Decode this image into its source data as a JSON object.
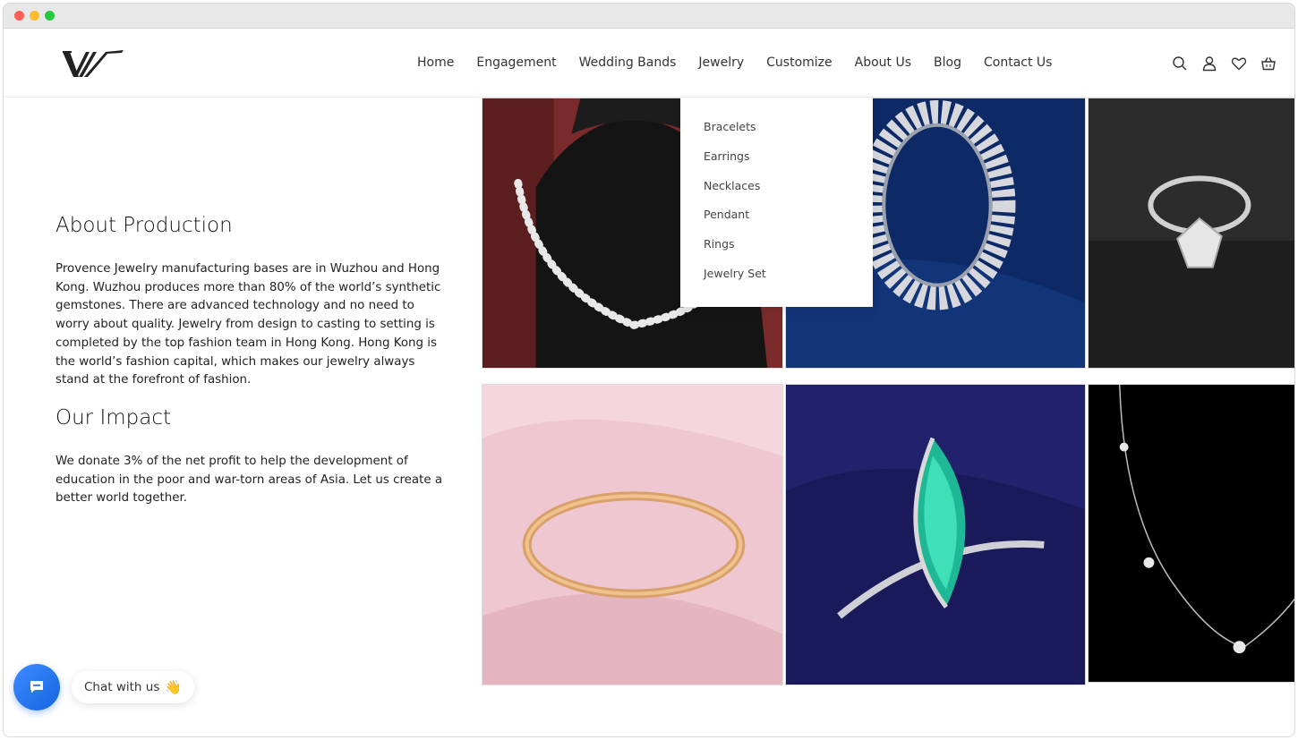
{
  "nav": {
    "items": [
      "Home",
      "Engagement",
      "Wedding Bands",
      "Jewelry",
      "Customize",
      "About Us",
      "Blog",
      "Contact Us"
    ]
  },
  "header_icons": [
    "search-icon",
    "user-icon",
    "heart-icon",
    "basket-icon"
  ],
  "dropdown": {
    "items": [
      "Bracelets",
      "Earrings",
      "Necklaces",
      "Pendant",
      "Rings",
      "Jewelry Set"
    ]
  },
  "about": {
    "title": "About Production",
    "body": "Provence Jewelry manufacturing bases are in Wuzhou and Hong Kong. Wuzhou produces more than 80% of the world’s synthetic gemstones. There are advanced technology and no need to worry about quality. Jewelry from design to casting to setting is completed by the top fashion team in Hong Kong. Hong Kong is the world’s fashion capital, which makes our jewelry always stand at the forefront of fashion."
  },
  "impact": {
    "title": "Our Impact",
    "body": "We donate 3% of the net profit to help the development of education in the poor and war-torn areas of Asia. Let us create a better world together."
  },
  "chat": {
    "label": "Chat with us",
    "emoji": "👋"
  },
  "colors": {
    "chat_button": "#1f74ec",
    "text": "#222222"
  }
}
